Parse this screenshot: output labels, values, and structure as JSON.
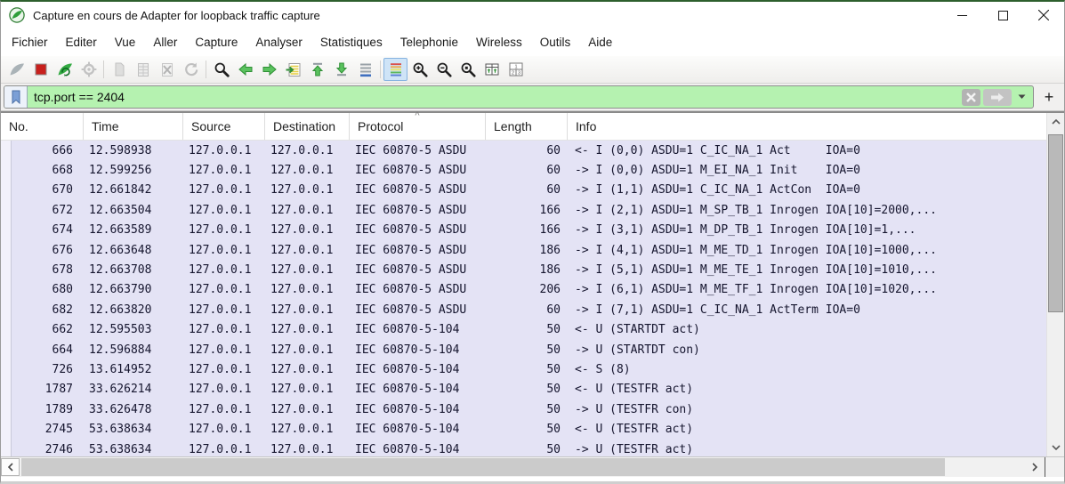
{
  "window": {
    "title": "Capture en cours de Adapter for loopback traffic capture",
    "control_icons": [
      "wireshark-logo-icon",
      "minimize-icon",
      "maximize-icon",
      "close-icon"
    ]
  },
  "menu": {
    "items": [
      "Fichier",
      "Editer",
      "Vue",
      "Aller",
      "Capture",
      "Analyser",
      "Statistiques",
      "Telephonie",
      "Wireless",
      "Outils",
      "Aide"
    ]
  },
  "toolbar": {
    "icons": [
      "start-capture-icon",
      "stop-capture-icon",
      "restart-capture-icon",
      "capture-options-icon",
      "open-file-icon",
      "save-file-icon",
      "close-file-icon",
      "reload-icon",
      "find-packet-icon",
      "go-back-icon",
      "go-forward-icon",
      "go-to-packet-icon",
      "first-packet-icon",
      "last-packet-icon",
      "auto-scroll-icon",
      "colorize-icon",
      "zoom-in-icon",
      "zoom-out-icon",
      "zoom-original-icon",
      "resize-columns-icon",
      "layout-123-icon"
    ],
    "active_icon": "colorize-icon"
  },
  "filter": {
    "value": "tcp.port == 2404",
    "valid_bg": "#b5f2b0",
    "add_label": "+",
    "icons": [
      "bookmark-icon",
      "clear-filter-icon",
      "apply-filter-icon",
      "dropdown-icon",
      "add-filter-button-icon"
    ]
  },
  "packet_list": {
    "columns": [
      "No.",
      "Time",
      "Source",
      "Destination",
      "Protocol",
      "Length",
      "Info"
    ],
    "sorted_column": "Protocol",
    "sort_indicator": "^",
    "row_colors": {
      "background": "#e4e3f5",
      "text": "#15152e"
    },
    "rows": [
      {
        "no": "666",
        "time": "12.598938",
        "source": "127.0.0.1",
        "destination": "127.0.0.1",
        "protocol": "IEC 60870-5 ASDU",
        "length": "60",
        "info": "<- I (0,0) ASDU=1 C_IC_NA_1 Act     IOA=0"
      },
      {
        "no": "668",
        "time": "12.599256",
        "source": "127.0.0.1",
        "destination": "127.0.0.1",
        "protocol": "IEC 60870-5 ASDU",
        "length": "60",
        "info": "-> I (0,0) ASDU=1 M_EI_NA_1 Init    IOA=0"
      },
      {
        "no": "670",
        "time": "12.661842",
        "source": "127.0.0.1",
        "destination": "127.0.0.1",
        "protocol": "IEC 60870-5 ASDU",
        "length": "60",
        "info": "-> I (1,1) ASDU=1 C_IC_NA_1 ActCon  IOA=0"
      },
      {
        "no": "672",
        "time": "12.663504",
        "source": "127.0.0.1",
        "destination": "127.0.0.1",
        "protocol": "IEC 60870-5 ASDU",
        "length": "166",
        "info": "-> I (2,1) ASDU=1 M_SP_TB_1 Inrogen IOA[10]=2000,..."
      },
      {
        "no": "674",
        "time": "12.663589",
        "source": "127.0.0.1",
        "destination": "127.0.0.1",
        "protocol": "IEC 60870-5 ASDU",
        "length": "166",
        "info": "-> I (3,1) ASDU=1 M_DP_TB_1 Inrogen IOA[10]=1,..."
      },
      {
        "no": "676",
        "time": "12.663648",
        "source": "127.0.0.1",
        "destination": "127.0.0.1",
        "protocol": "IEC 60870-5 ASDU",
        "length": "186",
        "info": "-> I (4,1) ASDU=1 M_ME_TD_1 Inrogen IOA[10]=1000,..."
      },
      {
        "no": "678",
        "time": "12.663708",
        "source": "127.0.0.1",
        "destination": "127.0.0.1",
        "protocol": "IEC 60870-5 ASDU",
        "length": "186",
        "info": "-> I (5,1) ASDU=1 M_ME_TE_1 Inrogen IOA[10]=1010,..."
      },
      {
        "no": "680",
        "time": "12.663790",
        "source": "127.0.0.1",
        "destination": "127.0.0.1",
        "protocol": "IEC 60870-5 ASDU",
        "length": "206",
        "info": "-> I (6,1) ASDU=1 M_ME_TF_1 Inrogen IOA[10]=1020,..."
      },
      {
        "no": "682",
        "time": "12.663820",
        "source": "127.0.0.1",
        "destination": "127.0.0.1",
        "protocol": "IEC 60870-5 ASDU",
        "length": "60",
        "info": "-> I (7,1) ASDU=1 C_IC_NA_1 ActTerm IOA=0"
      },
      {
        "no": "662",
        "time": "12.595503",
        "source": "127.0.0.1",
        "destination": "127.0.0.1",
        "protocol": "IEC 60870-5-104",
        "length": "50",
        "info": "<- U (STARTDT act)"
      },
      {
        "no": "664",
        "time": "12.596884",
        "source": "127.0.0.1",
        "destination": "127.0.0.1",
        "protocol": "IEC 60870-5-104",
        "length": "50",
        "info": "-> U (STARTDT con)"
      },
      {
        "no": "726",
        "time": "13.614952",
        "source": "127.0.0.1",
        "destination": "127.0.0.1",
        "protocol": "IEC 60870-5-104",
        "length": "50",
        "info": "<- S (8)"
      },
      {
        "no": "1787",
        "time": "33.626214",
        "source": "127.0.0.1",
        "destination": "127.0.0.1",
        "protocol": "IEC 60870-5-104",
        "length": "50",
        "info": "<- U (TESTFR act)"
      },
      {
        "no": "1789",
        "time": "33.626478",
        "source": "127.0.0.1",
        "destination": "127.0.0.1",
        "protocol": "IEC 60870-5-104",
        "length": "50",
        "info": "-> U (TESTFR con)"
      },
      {
        "no": "2745",
        "time": "53.638634",
        "source": "127.0.0.1",
        "destination": "127.0.0.1",
        "protocol": "IEC 60870-5-104",
        "length": "50",
        "info": "<- U (TESTFR act)"
      },
      {
        "no": "2746",
        "time": "53.638634",
        "source": "127.0.0.1",
        "destination": "127.0.0.1",
        "protocol": "IEC 60870-5-104",
        "length": "50",
        "info": "-> U (TESTFR act)"
      }
    ]
  }
}
